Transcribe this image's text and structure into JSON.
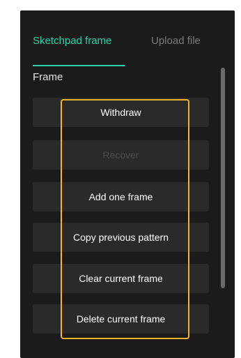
{
  "tabs": {
    "sketchpad_label": "Sketchpad frame",
    "upload_label": "Upload file",
    "active_color": "#26d3a8",
    "inactive_color": "#7b7b7b"
  },
  "frame_section": {
    "title": "Frame"
  },
  "actions": [
    {
      "label": "Withdraw",
      "enabled": true
    },
    {
      "label": "Recover",
      "enabled": false
    },
    {
      "label": "Add one frame",
      "enabled": true
    },
    {
      "label": "Copy previous pattern",
      "enabled": true
    },
    {
      "label": "Clear current frame",
      "enabled": true
    },
    {
      "label": "Delete current frame",
      "enabled": true
    }
  ],
  "colors": {
    "panel_bg": "#1b1b1b",
    "button_bg": "#2a2a2a",
    "highlight_border": "#f5b52b"
  }
}
